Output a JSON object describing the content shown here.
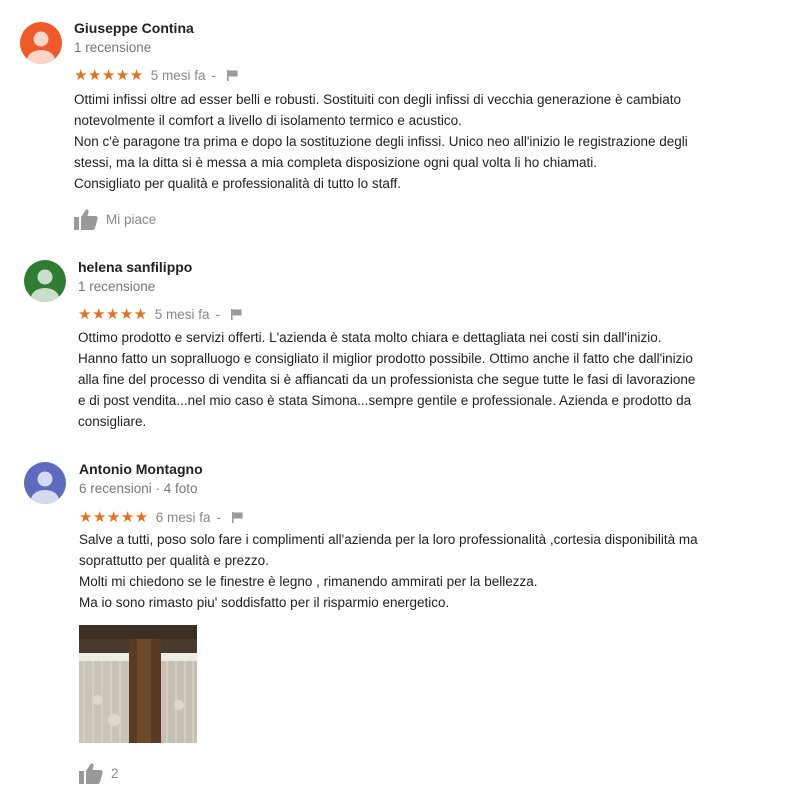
{
  "colors": {
    "star": "#e7711b",
    "meta_gray": "#888888",
    "avatar_1": "#f05a28",
    "avatar_2": "#2e7d32",
    "avatar_3": "#5c6bc0"
  },
  "icons": {
    "like": "thumbs-up-icon",
    "report": "flag-icon",
    "avatar": "person-icon"
  },
  "reviews": [
    {
      "author": "Giuseppe Contina",
      "count": "1 recensione",
      "stars": "★★★★★",
      "rating": 5,
      "ago": "5 mesi fa",
      "dash": "-",
      "lines": [
        "Ottimi infissi oltre ad esser belli e robusti. Sostituiti con degli infissi di vecchia generazione è cambiato",
        "notevolmente il comfort a livello di isolamento termico e acustico.",
        "Non c'è paragone tra prima e dopo la sostituzione degli infissi. Unico neo all'inizio le registrazione degli",
        "stessi, ma la ditta si è messa a mia completa disposizione ogni qual volta li ho chiamati.",
        "Consigliato per qualità e professionalità di tutto lo staff."
      ],
      "like_label": "Mi piace"
    },
    {
      "author": "helena sanfilippo",
      "count": "1 recensione",
      "stars": "★★★★★",
      "rating": 5,
      "ago": "5 mesi fa",
      "dash": "-",
      "lines": [
        "Ottimo prodotto e servizi offerti. L'azienda è stata molto chiara e dettagliata nei costi sin dall'inizio.",
        "Hanno fatto un sopralluogo e consigliato il miglior prodotto possibile. Ottimo anche il fatto che dall'inizio",
        "alla fine del processo di vendita si è affiancati  da un professionista che segue tutte le fasi di lavorazione",
        "e di post vendita...nel mio caso è stata Simona...sempre gentile e professionale. Azienda e prodotto da",
        "consigliare."
      ]
    },
    {
      "author": "Antonio Montagno",
      "count": "6 recensioni · 4 foto",
      "stars": "★★★★★",
      "rating": 5,
      "ago": "6 mesi fa",
      "dash": "-",
      "lines": [
        "Salve a tutti, poso solo fare i complimenti all'azienda per la loro professionalità ,cortesia disponibilità ma",
        "soprattutto per  qualità e prezzo.",
        "Molti mi chiedono se le finestre è legno ,  rimanendo ammirati per la bellezza.",
        "Ma io sono rimasto piu' soddisfatto per il risparmio energetico."
      ],
      "like_count": "2"
    }
  ]
}
